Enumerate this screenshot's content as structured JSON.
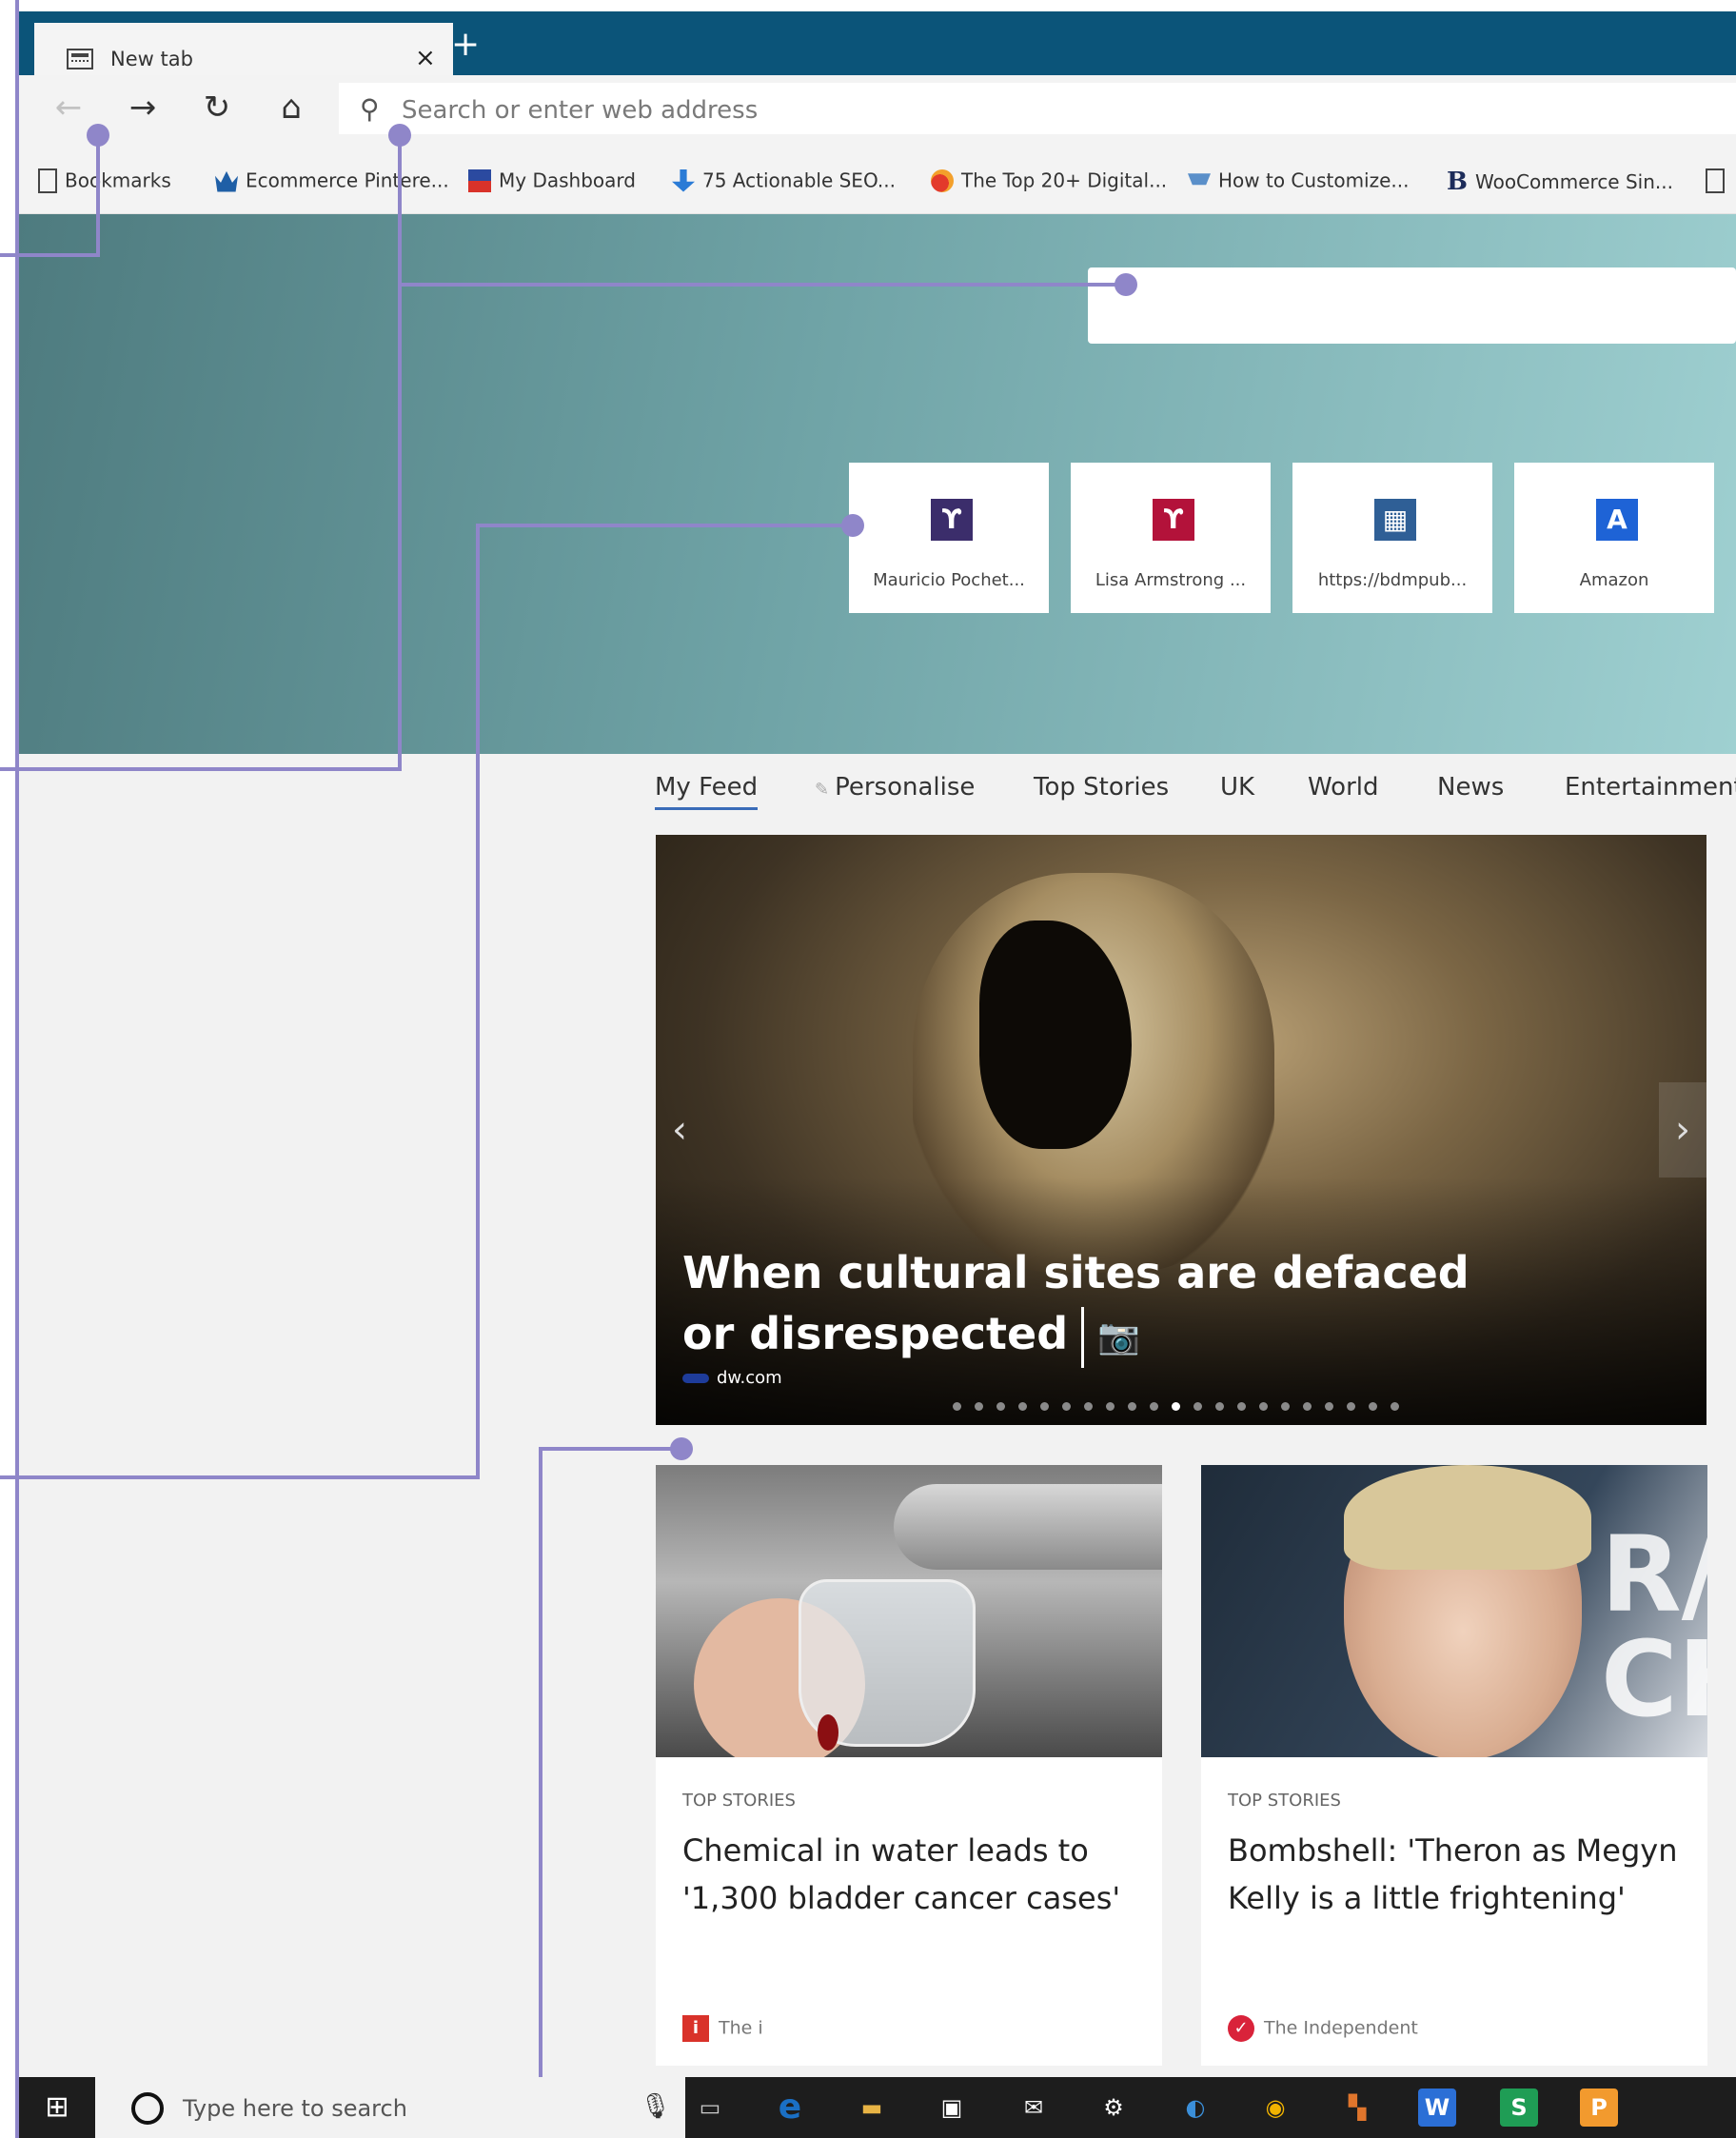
{
  "browser": {
    "tab": {
      "title": "New tab",
      "close_glyph": "×",
      "icon": "newtab-page-icon"
    },
    "new_tab_glyph": "+",
    "nav": {
      "back_glyph": "←",
      "forward_glyph": "→",
      "refresh_glyph": "↻",
      "home_glyph": "⌂",
      "address_placeholder": "Search or enter web address"
    },
    "favorites": [
      {
        "label": "Bookmarks",
        "icon": "document-icon"
      },
      {
        "label": "Ecommerce Pintere...",
        "icon": "crown-icon"
      },
      {
        "label": "My Dashboard",
        "icon": "dashboard-icon"
      },
      {
        "label": "75 Actionable SEO...",
        "icon": "seo-icon"
      },
      {
        "label": "The Top 20+ Digital...",
        "icon": "digital-icon"
      },
      {
        "label": "How to Customize...",
        "icon": "cart-icon"
      },
      {
        "label": "WooCommerce Sin...",
        "icon": "b-logo-icon",
        "logo_glyph": "B"
      }
    ]
  },
  "top_sites": [
    {
      "label": "Mauricio Pochet...",
      "logo_glyph": "ϒ",
      "color": "#3b2d6b"
    },
    {
      "label": "Lisa Armstrong ...",
      "logo_glyph": "ϒ",
      "color": "#b3123a"
    },
    {
      "label": "https://bdmpub...",
      "logo_glyph": "▦",
      "color": "#2f5f96"
    },
    {
      "label": "Amazon",
      "logo_glyph": "A",
      "color": "#1e63d6"
    }
  ],
  "feed_tabs": [
    {
      "label": "My Feed",
      "active": true
    },
    {
      "label": "Personalise",
      "icon": "pencil-icon",
      "icon_glyph": "✎"
    },
    {
      "label": "Top Stories"
    },
    {
      "label": "UK"
    },
    {
      "label": "World"
    },
    {
      "label": "News"
    },
    {
      "label": "Entertainment"
    }
  ],
  "hero_story": {
    "title": "When cultural sites are defaced or disrespected",
    "camera_glyph": "📷",
    "source": "dw.com",
    "prev_glyph": "‹",
    "next_glyph": "›",
    "carousel_count": 21,
    "carousel_active_index": 10
  },
  "cards": [
    {
      "category": "TOP STORIES",
      "headline": "Chemical in water leads to '1,300 bladder cancer cases'",
      "source": "The i",
      "source_logo_glyph": "i",
      "source_color": "#d9322a"
    },
    {
      "category": "TOP STORIES",
      "headline": "Bombshell: 'Theron as Megyn Kelly is a little frightening'",
      "source": "The Independent",
      "source_logo_glyph": "✓",
      "source_color": "#d9233a"
    }
  ],
  "taskbar": {
    "start_glyph": "⊞",
    "search_placeholder": "Type here to search",
    "mic_glyph": "🎙",
    "apps": [
      {
        "name": "task-view-icon",
        "glyph": "▭",
        "color": "#1d1d1d"
      },
      {
        "name": "edge-icon",
        "glyph": "e",
        "color": "#1a6fc4"
      },
      {
        "name": "file-explorer-icon",
        "glyph": "▬",
        "color": "#e8b445"
      },
      {
        "name": "store-icon",
        "glyph": "▣",
        "color": "#2b2b2b"
      },
      {
        "name": "mail-icon",
        "glyph": "✉",
        "color": "#1d1d1d"
      },
      {
        "name": "settings-icon",
        "glyph": "⚙",
        "color": "#1d1d1d"
      },
      {
        "name": "app-icon",
        "glyph": "◐",
        "color": "#1d1d1d"
      },
      {
        "name": "chrome-icon",
        "glyph": "◉",
        "color": "#d93025"
      },
      {
        "name": "app2-icon",
        "glyph": "▚",
        "color": "#2d7d46"
      },
      {
        "name": "word-icon",
        "glyph": "W",
        "color": "#2b6fd6"
      },
      {
        "name": "sheets-icon",
        "glyph": "S",
        "color": "#1f9d55"
      },
      {
        "name": "slides-icon",
        "glyph": "P",
        "color": "#f29a2e"
      }
    ]
  },
  "colors": {
    "accent": "#0b5479",
    "annotation": "#8f86c9",
    "active_tab_underline": "#3a6cb8"
  }
}
